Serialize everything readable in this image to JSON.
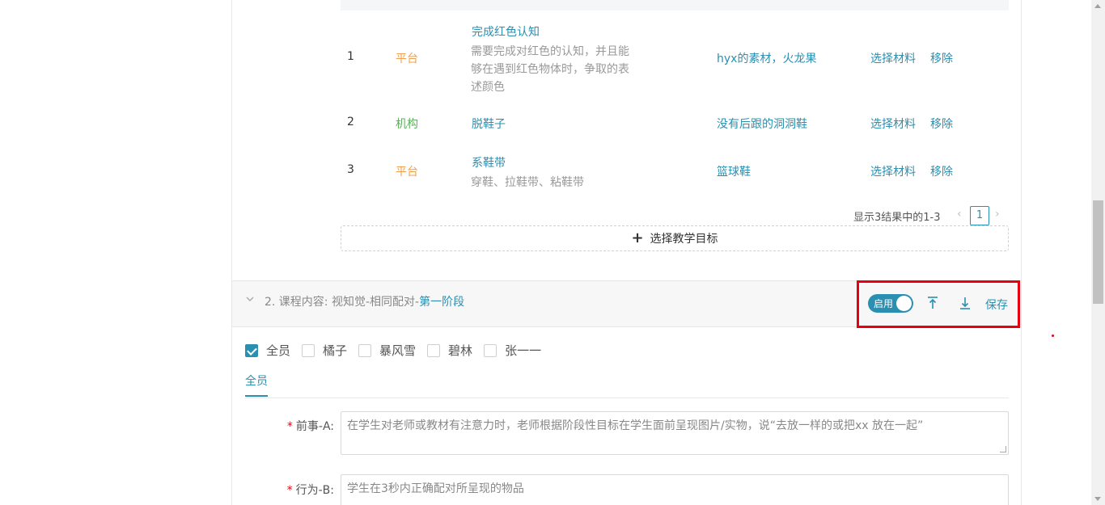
{
  "targets_table": {
    "rows": [
      {
        "index": "1",
        "source": "平台",
        "source_type": "platform",
        "title": "完成红色认知",
        "description": "需要完成对红色的认知，并且能够在遇到红色物体时，争取的表述颜色",
        "material": "hyx的素材，火龙果",
        "select_material": "选择材料",
        "remove": "移除"
      },
      {
        "index": "2",
        "source": "机构",
        "source_type": "org",
        "title": "脱鞋子",
        "description": "",
        "material": "没有后跟的洞洞鞋",
        "select_material": "选择材料",
        "remove": "移除"
      },
      {
        "index": "3",
        "source": "平台",
        "source_type": "platform",
        "title": "系鞋带",
        "description": "穿鞋、拉鞋带、粘鞋带",
        "material": "篮球鞋",
        "select_material": "选择材料",
        "remove": "移除"
      }
    ],
    "pagination": {
      "summary": "显示3结果中的1-3",
      "current_page": "1",
      "prev_icon": "chevron-left-icon",
      "next_icon": "chevron-right-icon"
    },
    "add_button": "选择教学目标"
  },
  "section2": {
    "title_prefix": "2. 课程内容: 视知觉-相同配对-",
    "title_stage": "第一阶段",
    "toggle_label": "启用",
    "toggle_on": true,
    "save_label": "保存",
    "accent_color": "#2a8fb0",
    "highlight_color": "#e60012"
  },
  "members": [
    {
      "label": "全员",
      "checked": true
    },
    {
      "label": "橘子",
      "checked": false
    },
    {
      "label": "暴风雪",
      "checked": false
    },
    {
      "label": "碧林",
      "checked": false
    },
    {
      "label": "张一一",
      "checked": false
    }
  ],
  "tabs": {
    "active": "全员"
  },
  "form": {
    "antecedent_label": "前事-A:",
    "antecedent_value": "在学生对老师或教材有注意力时，老师根据阶段性目标在学生面前呈现图片/实物，说“去放一样的或把xx 放在一起”",
    "behavior_label": "行为-B:",
    "behavior_value": "学生在3秒内正确配对所呈现的物品"
  }
}
